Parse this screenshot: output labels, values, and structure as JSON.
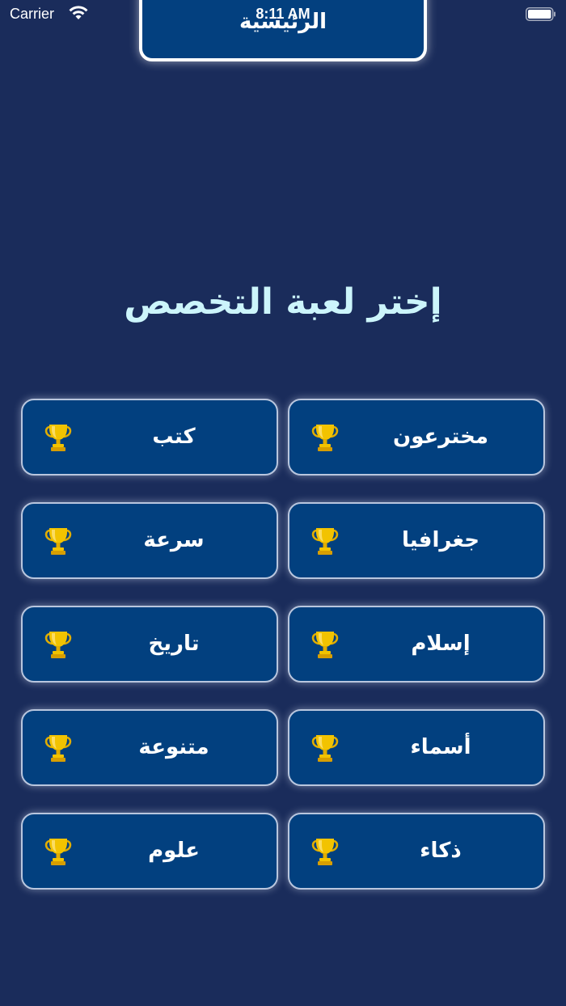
{
  "status_bar": {
    "carrier": "Carrier",
    "time": "8:11 AM"
  },
  "header": {
    "home_label": "الرئيسية"
  },
  "title": "إختر لعبة التخصص",
  "categories": [
    {
      "label": "كتب",
      "icon": "trophy-icon"
    },
    {
      "label": "مخترعون",
      "icon": "trophy-icon"
    },
    {
      "label": "سرعة",
      "icon": "trophy-icon"
    },
    {
      "label": "جغرافيا",
      "icon": "trophy-icon"
    },
    {
      "label": "تاريخ",
      "icon": "trophy-icon"
    },
    {
      "label": "إسلام",
      "icon": "trophy-icon"
    },
    {
      "label": "متنوعة",
      "icon": "trophy-icon"
    },
    {
      "label": "أسماء",
      "icon": "trophy-icon"
    },
    {
      "label": "علوم",
      "icon": "trophy-icon"
    },
    {
      "label": "ذكاء",
      "icon": "trophy-icon"
    }
  ],
  "colors": {
    "background": "#1a2c5b",
    "button": "#02407f",
    "title": "#ccf5fb",
    "trophy": "#f2c300"
  }
}
